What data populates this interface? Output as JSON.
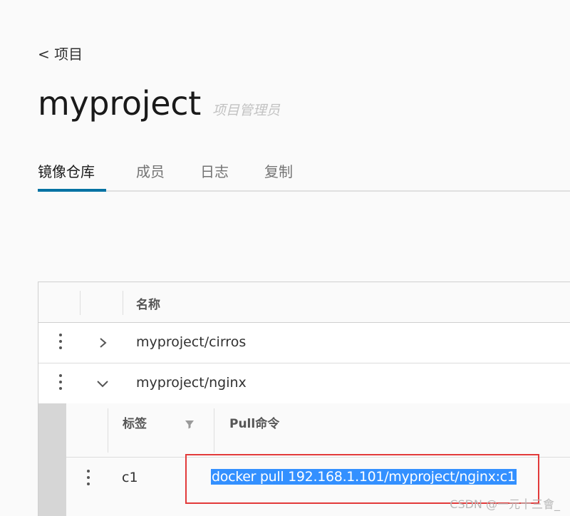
{
  "breadcrumb": {
    "back_label": "< 项目"
  },
  "project": {
    "name": "myproject",
    "role": "项目管理员"
  },
  "tabs": [
    {
      "label": "镜像仓库",
      "active": true
    },
    {
      "label": "成员",
      "active": false
    },
    {
      "label": "日志",
      "active": false
    },
    {
      "label": "复制",
      "active": false
    }
  ],
  "repositories": {
    "column_header": "名称",
    "rows": [
      {
        "name": "myproject/cirros",
        "expanded": false
      },
      {
        "name": "myproject/nginx",
        "expanded": true
      }
    ]
  },
  "tags_table": {
    "columns": {
      "tag": "标签",
      "pull_command": "Pull命令"
    },
    "rows": [
      {
        "tag": "c1",
        "pull_command": "docker pull 192.168.1.101/myproject/nginx:c1"
      }
    ]
  },
  "colors": {
    "accent": "#0072a3",
    "selection": "#3390ff",
    "highlight_border": "#e23a3a"
  },
  "watermark": "CSDN @一元十三會_"
}
